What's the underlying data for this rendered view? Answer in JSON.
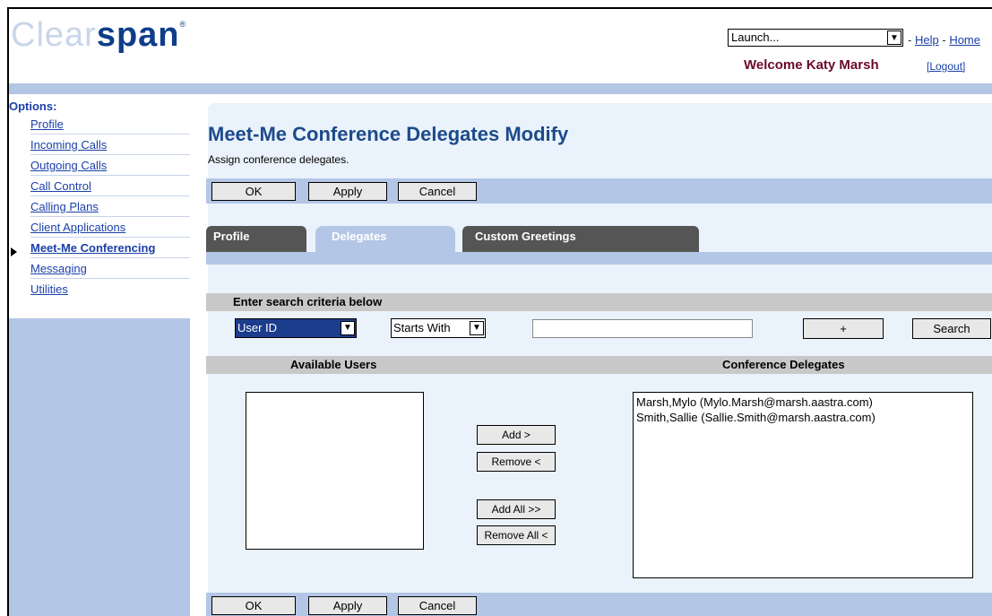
{
  "header": {
    "logo_part1": "Clear",
    "logo_part2": "span",
    "logo_mark": "®",
    "launch_value": "Launch...",
    "help_prefix": "-",
    "help_label": "Help",
    "home_prefix": "-",
    "home_label": "Home",
    "welcome": "Welcome Katy Marsh",
    "logout": "[Logout]"
  },
  "sidebar": {
    "label": "Options:",
    "items": [
      {
        "label": "Profile"
      },
      {
        "label": "Incoming Calls"
      },
      {
        "label": "Outgoing Calls"
      },
      {
        "label": "Call Control"
      },
      {
        "label": "Calling Plans"
      },
      {
        "label": "Client Applications"
      },
      {
        "label": "Meet-Me Conferencing"
      },
      {
        "label": "Messaging"
      },
      {
        "label": "Utilities"
      }
    ]
  },
  "page": {
    "title": "Meet-Me Conference Delegates Modify",
    "subtitle": "Assign conference delegates."
  },
  "buttons": {
    "ok": "OK",
    "apply": "Apply",
    "cancel": "Cancel"
  },
  "tabs": [
    {
      "label": "Profile"
    },
    {
      "label": "Delegates"
    },
    {
      "label": "Custom Greetings"
    }
  ],
  "search": {
    "header": "Enter search criteria below",
    "field_value": "User ID",
    "mode_value": "Starts With",
    "text_value": "",
    "plus_label": "+",
    "search_label": "Search"
  },
  "lists": {
    "available_header": "Available Users",
    "delegates_header": "Conference Delegates",
    "available": [],
    "delegates": [
      "Marsh,Mylo (Mylo.Marsh@marsh.aastra.com)",
      "Smith,Sallie (Sallie.Smith@marsh.aastra.com)"
    ]
  },
  "move_buttons": {
    "add": "Add >",
    "remove": "Remove <",
    "add_all": "Add All >>",
    "remove_all": "Remove All <"
  },
  "icons": {
    "dropdown": "chevron-down-icon",
    "current_item": "arrow-right-icon"
  }
}
